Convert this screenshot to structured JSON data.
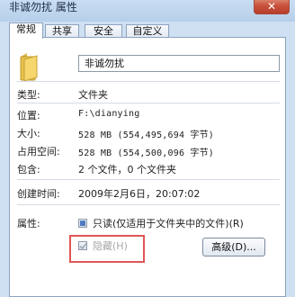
{
  "window": {
    "title": "非诚勿扰 属性",
    "close_glyph": "✕"
  },
  "tabs": [
    {
      "label": "常规",
      "active": true
    },
    {
      "label": "共享",
      "active": false
    },
    {
      "label": "安全",
      "active": false
    },
    {
      "label": "自定义",
      "active": false
    }
  ],
  "general": {
    "folder_icon": "folder-icon",
    "name_value": "非诚勿扰",
    "fields": {
      "type": {
        "label": "类型:",
        "value": "文件夹"
      },
      "location": {
        "label": "位置:",
        "value": "F:\\dianying"
      },
      "size": {
        "label": "大小:",
        "value": "528 MB (554,495,694 字节)"
      },
      "size_on_disk": {
        "label": "占用空间:",
        "value": "528 MB (554,500,096 字节)"
      },
      "contains": {
        "label": "包含:",
        "value": "2 个文件，0 个文件夹"
      },
      "created": {
        "label": "创建时间:",
        "value": "2009年2月6日，20:07:02"
      }
    },
    "attributes": {
      "label": "属性:",
      "readonly": {
        "label": "只读(仅适用于文件夹中的文件)(R)",
        "state": "indeterminate"
      },
      "hidden": {
        "label": "隐藏(H)",
        "state": "checked-disabled"
      },
      "advanced_button": "高级(D)..."
    }
  },
  "colors": {
    "highlight_box": "#e05555",
    "window_frame": "#cfe0f3",
    "close_button": "#c9533d"
  }
}
